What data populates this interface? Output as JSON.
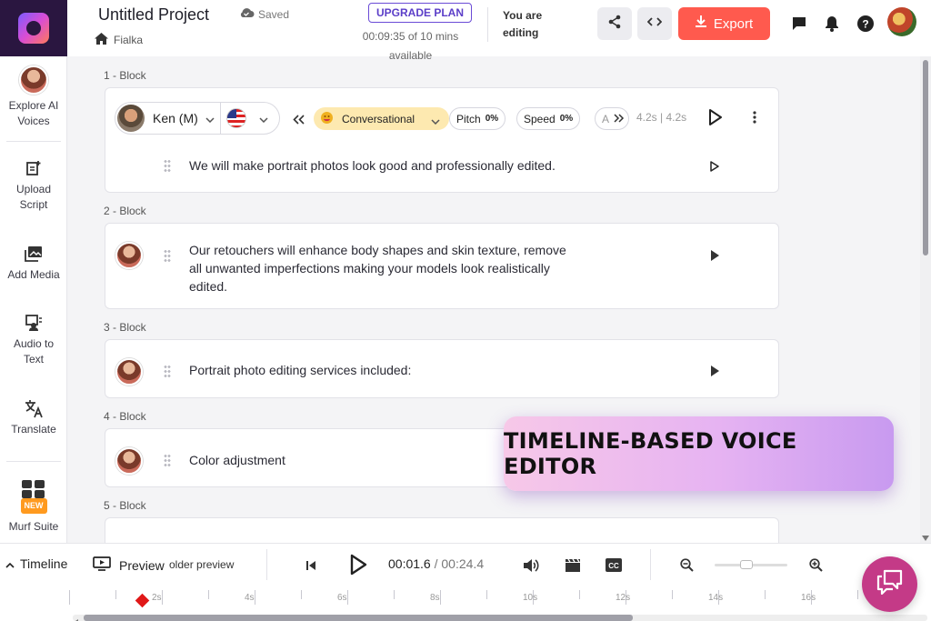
{
  "sidebar": {
    "items": [
      {
        "label": "Explore AI Voices"
      },
      {
        "label": "Upload Script"
      },
      {
        "label": "Add Media"
      },
      {
        "label": "Audio to Text"
      },
      {
        "label": "Translate"
      },
      {
        "label": "Murf Suite",
        "badge": "NEW"
      }
    ]
  },
  "header": {
    "title": "Untitled Project",
    "saved": "Saved",
    "breadcrumb": "Fialka",
    "upgrade": "UPGRADE PLAN",
    "time_left": "00:09:35 of 10 mins available",
    "editing": "You are editing",
    "export": "Export"
  },
  "blocks": [
    {
      "label": "1 -  Block",
      "voice": "Ken (M)",
      "style": "Conversational",
      "pitch_label": "Pitch",
      "pitch": "0%",
      "speed_label": "Speed",
      "speed": "0%",
      "more": "A",
      "duration": "4.2s | 4.2s",
      "text": "We will make portrait photos look good and professionally edited."
    },
    {
      "label": "2 -  Block",
      "text": "Our retouchers will enhance body shapes and skin texture, remove all unwanted imperfections making your models look realistically edited."
    },
    {
      "label": "3 -  Block",
      "text": "Portrait photo editing services included:"
    },
    {
      "label": "4 -  Block",
      "text": "Color adjustment"
    },
    {
      "label": "5 -  Block"
    }
  ],
  "overlay": {
    "text": "TIMELINE-BASED VOICE EDITOR"
  },
  "bottombar": {
    "timeline": "Timeline",
    "preview": "Preview",
    "preview_hint": "older preview",
    "current": "00:01.6",
    "sep": " / ",
    "total": "00:24.4"
  },
  "ruler": {
    "ticks": [
      "2s",
      "4s",
      "6s",
      "8s",
      "10s",
      "12s",
      "14s",
      "16s"
    ]
  },
  "colors": {
    "accent": "#ff5a4e",
    "brand": "#2a1640",
    "style_pill": "#fde9b0",
    "playhead": "#e01818"
  }
}
